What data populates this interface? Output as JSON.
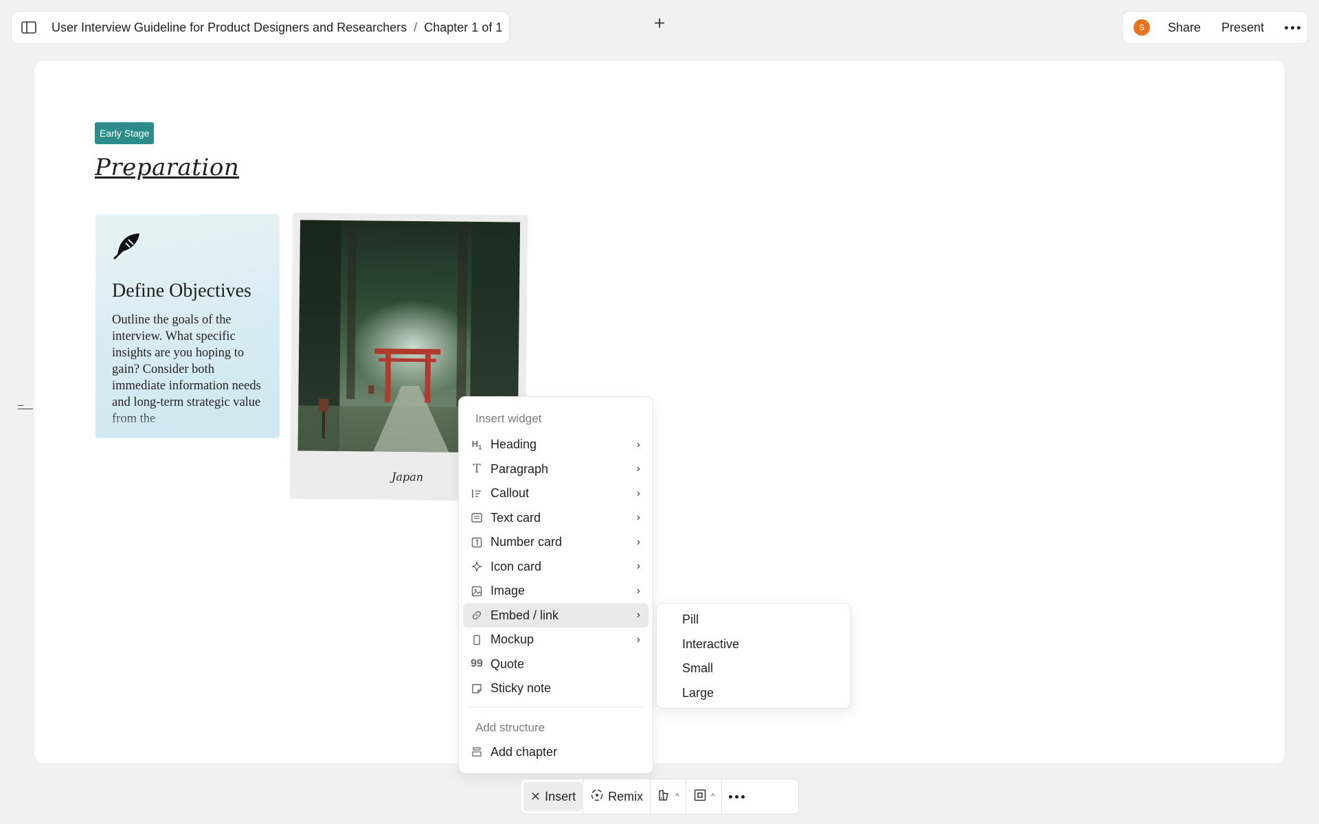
{
  "header": {
    "doc_title": "User Interview Guideline for Product Designers and Researchers",
    "separator": "/",
    "chapter": "Chapter 1 of 1",
    "add_label": "+",
    "avatar_initial": "S",
    "share_label": "Share",
    "present_label": "Present"
  },
  "canvas": {
    "badge": "Early Stage",
    "title": "Preparation",
    "text_card": {
      "heading": "Define Objectives",
      "body": "Outline the goals of the interview. What specific insights are you hoping to gain? Consider both immediate information needs and long-term strategic value from the"
    },
    "photo_card": {
      "caption": "Japan"
    }
  },
  "insert_menu": {
    "section_widgets": "Insert widget",
    "items": [
      {
        "label": "Heading",
        "icon": "H1",
        "submenu": true
      },
      {
        "label": "Paragraph",
        "icon": "T",
        "submenu": true
      },
      {
        "label": "Callout",
        "icon": "callout-icon",
        "submenu": true
      },
      {
        "label": "Text card",
        "icon": "text-card-icon",
        "submenu": true
      },
      {
        "label": "Number card",
        "icon": "1",
        "submenu": true
      },
      {
        "label": "Icon card",
        "icon": "sparkle-icon",
        "submenu": true
      },
      {
        "label": "Image",
        "icon": "image-icon",
        "submenu": true
      },
      {
        "label": "Embed / link",
        "icon": "link-icon",
        "submenu": true
      },
      {
        "label": "Mockup",
        "icon": "phone-icon",
        "submenu": true
      },
      {
        "label": "Quote",
        "icon": "quote-icon",
        "submenu": false
      },
      {
        "label": "Sticky note",
        "icon": "sticky-note-icon",
        "submenu": false
      }
    ],
    "section_structure": "Add structure",
    "add_chapter": "Add chapter"
  },
  "embed_submenu": {
    "items": [
      "Pill",
      "Interactive",
      "Small",
      "Large"
    ]
  },
  "toolbar": {
    "insert_label": "Insert",
    "remix_label": "Remix"
  },
  "colors": {
    "badge": "#2c8b8b",
    "avatar": "#e8731c",
    "canvas_bg": "#ffffff",
    "page_bg": "#f1f1f1"
  }
}
